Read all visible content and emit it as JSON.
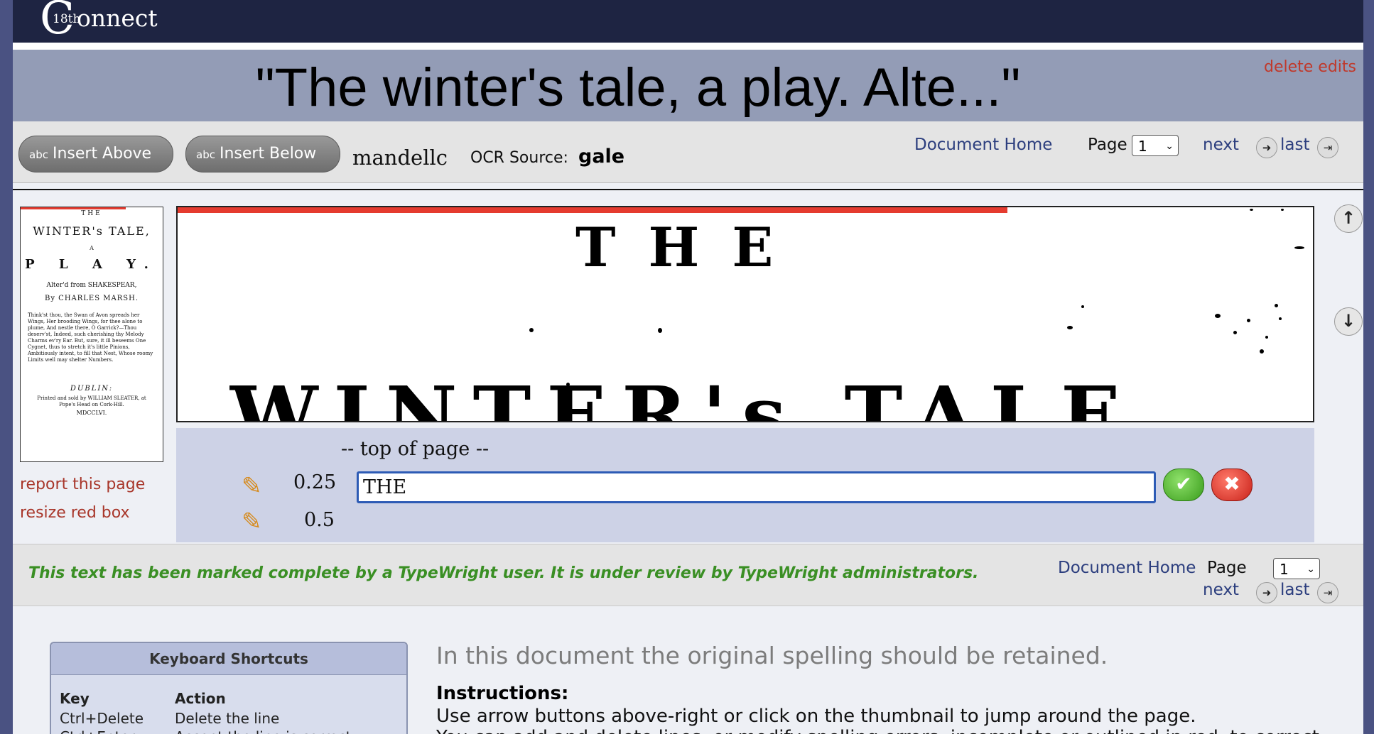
{
  "app": {
    "logo_text": "onnect",
    "logo_sup": "18th",
    "logo_c": "C"
  },
  "header": {
    "title": "\"The winter's tale, a play. Alte...\"",
    "delete_edits": "delete edits"
  },
  "toolbar": {
    "insert_above": "Insert Above",
    "insert_below": "Insert Below",
    "insert_icon": "abc",
    "username": "mandellc",
    "ocr_label": "OCR Source:",
    "ocr_value": "gale",
    "document_home": "Document Home",
    "page_label": "Page",
    "page_value": "1",
    "next": "next",
    "last": "last"
  },
  "thumbnail": {
    "line1": "THE",
    "line2": "WINTER's TALE,",
    "line3": "A",
    "line4": "P L A Y.",
    "line5": "Alter'd from SHAKESPEAR,",
    "line6": "By CHARLES MARSH.",
    "poem": "Think'st thou, the Swan of Avon spreads her Wings, Her brooding Wings, for thee alone to plume, And nestle there, O Garrick?—Thou deserv'st, Indeed, such cherishing thy Melody Charms ev'ry Ear. But, sure, it ill beseems One Cygnet, thus to stretch it's little Pinions, Ambitiously intent, to fill that Nest, Whose roomy Limits well may shelter Numbers.",
    "imprint1": "DUBLIN:",
    "imprint2": "Printed and sold by WILLIAM SLEATER, at Pope's Head on Cork-Hill.",
    "imprint3": "MDCCLVI."
  },
  "scan": {
    "text_top": "THE",
    "text_bottom": "WINTER's TALE"
  },
  "left_links": {
    "report": "report this page",
    "resize": "resize red box"
  },
  "editor": {
    "top_of_page": "-- top of page --",
    "lines": [
      {
        "number": "0.25",
        "text": "THE"
      },
      {
        "number": "0.5",
        "text": ""
      }
    ]
  },
  "status": {
    "message": "This text has been marked complete by a TypeWright user. It is under review by TypeWright administrators.",
    "document_home": "Document Home",
    "page_label": "Page",
    "page_value": "1",
    "next": "next",
    "last": "last"
  },
  "shortcuts": {
    "heading": "Keyboard Shortcuts",
    "col_key": "Key",
    "col_action": "Action",
    "rows": [
      {
        "key": "Ctrl+Delete",
        "action": "Delete the line"
      },
      {
        "key": "Ctrl+Enter",
        "action": "Accept the line is correct"
      }
    ]
  },
  "instructions": {
    "retained": "In this document the original spelling should be retained.",
    "heading": "Instructions:",
    "line1": "Use arrow buttons above-right or click on the thumbnail to jump around the page.",
    "line2": "You can add and delete lines, or modify spelling errors, incomplete or outlined in red, to correct"
  },
  "colors": {
    "accent_link": "#2c3e7e",
    "status_green": "#3a8f24",
    "danger_red": "#c0392b"
  }
}
